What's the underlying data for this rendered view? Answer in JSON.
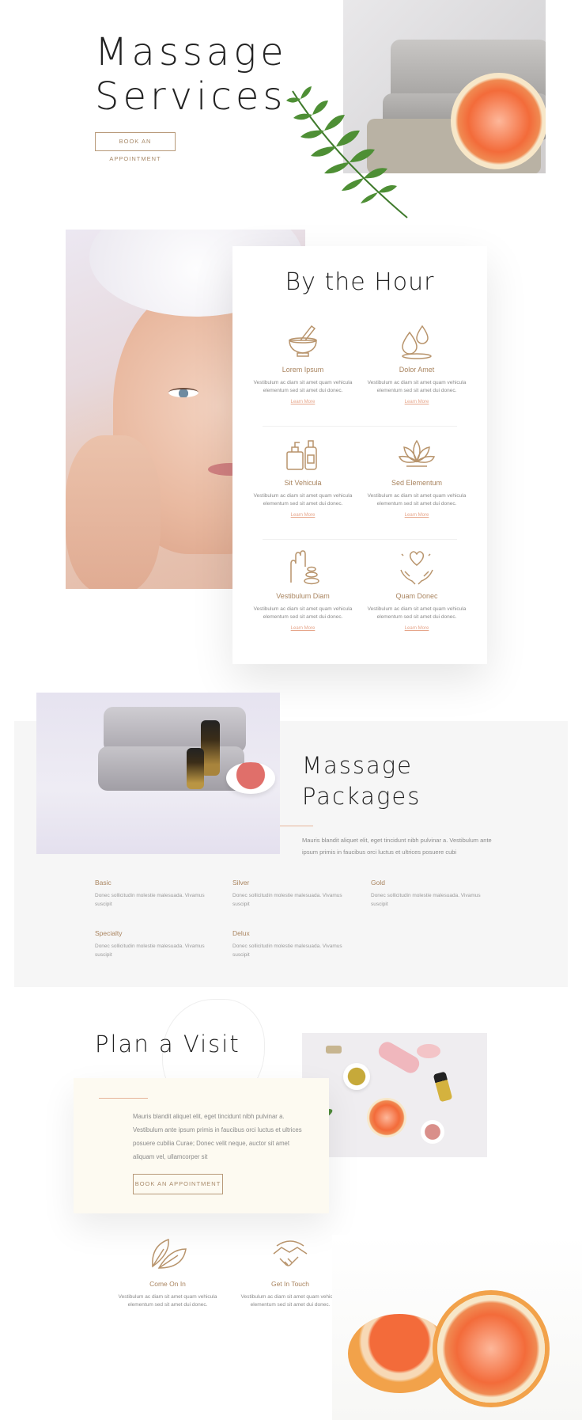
{
  "hero": {
    "title_line1": "Massage",
    "title_line2": "Services",
    "button_label": "BOOK AN APPOINTMENT"
  },
  "by_the_hour": {
    "title": "By the Hour",
    "services": [
      {
        "icon": "mortar-pestle-icon",
        "name": "Lorem Ipsum",
        "desc": "Vestibulum ac diam sit amet quam vehicula elementum sed sit amet dui donec.",
        "link": "Learn More"
      },
      {
        "icon": "oil-drops-icon",
        "name": "Dolor Amet",
        "desc": "Vestibulum ac diam sit amet quam vehicula elementum sed sit amet dui donec.",
        "link": "Learn More"
      },
      {
        "icon": "lotion-bottles-icon",
        "name": "Sit Vehicula",
        "desc": "Vestibulum ac diam sit amet quam vehicula elementum sed sit amet dui donec.",
        "link": "Learn More"
      },
      {
        "icon": "lotus-icon",
        "name": "Sed Elementum",
        "desc": "Vestibulum ac diam sit amet quam vehicula elementum sed sit amet dui donec.",
        "link": "Learn More"
      },
      {
        "icon": "hand-stones-icon",
        "name": "Vestibulum Diam",
        "desc": "Vestibulum ac diam sit amet quam vehicula elementum sed sit amet dui donec.",
        "link": "Learn More"
      },
      {
        "icon": "heart-hands-icon",
        "name": "Quam Donec",
        "desc": "Vestibulum ac diam sit amet quam vehicula elementum sed sit amet dui donec.",
        "link": "Learn More"
      }
    ]
  },
  "packages": {
    "title_line1": "Massage",
    "title_line2": "Packages",
    "text": "Mauris blandit aliquet elit, eget tincidunt nibh pulvinar a. Vestibulum ante ipsum primis in faucibus orci luctus et ultrices posuere cubi",
    "items": [
      {
        "name": "Basic",
        "desc": "Donec sollicitudin molestie malesuada. Vivamus suscipit"
      },
      {
        "name": "Silver",
        "desc": "Donec sollicitudin molestie malesuada. Vivamus suscipit"
      },
      {
        "name": "Gold",
        "desc": "Donec sollicitudin molestie malesuada. Vivamus suscipit"
      },
      {
        "name": "Specialty",
        "desc": "Donec sollicitudin molestie malesuada. Vivamus suscipit"
      },
      {
        "name": "Delux",
        "desc": "Donec sollicitudin molestie malesuada. Vivamus suscipit"
      }
    ]
  },
  "plan_visit": {
    "title": "Plan a Visit",
    "text": "Mauris blandit aliquet elit, eget tincidunt nibh pulvinar a. Vestibulum ante ipsum primis in faucibus orci luctus et ultrices posuere cubilia Curae; Donec velit neque, auctor sit amet aliquam vel, ullamcorper sit",
    "button_label": "BOOK AN APPOINTMENT",
    "info": [
      {
        "icon": "leaf-icon",
        "name": "Come On In",
        "desc": "Vestibulum ac diam sit amet quam vehicula elementum sed sit amet dui donec."
      },
      {
        "icon": "handshake-icon",
        "name": "Get In Touch",
        "desc": "Vestibulum ac diam sit amet quam vehicula elementum sed sit amet dui donec."
      }
    ]
  },
  "colors": {
    "accent": "#a9845f",
    "link": "#e6a58a",
    "packages_bg": "#f6f6f6",
    "card_cream": "#fdfaf1"
  }
}
